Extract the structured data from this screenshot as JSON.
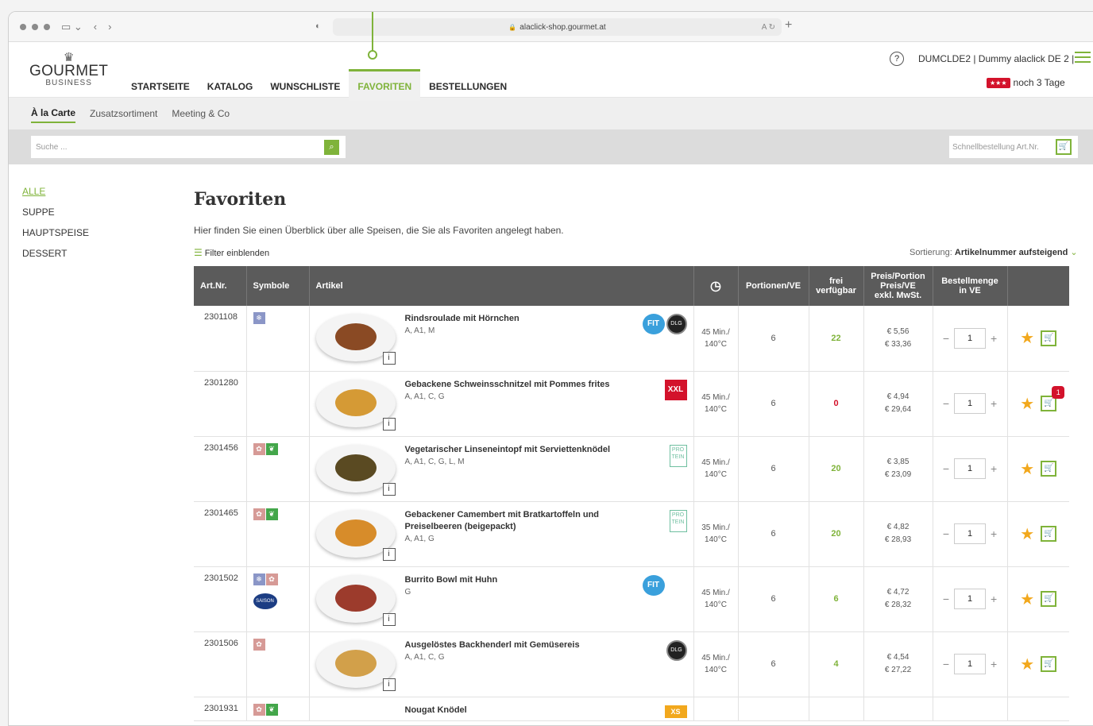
{
  "browser": {
    "url": "alaclick-shop.gourmet.at",
    "translate_label": "A",
    "reload_label": "↻"
  },
  "brand": {
    "line1": "GOURMET",
    "line2": "BUSINESS"
  },
  "nav": {
    "items": [
      "STARTSEITE",
      "KATALOG",
      "WUNSCHLISTE",
      "FAVORITEN",
      "BESTELLUNGEN"
    ],
    "active": "FAVORITEN"
  },
  "user": {
    "label": "DUMCLDE2 | Dummy alaclick DE 2 |",
    "help": "?"
  },
  "trial": {
    "badge": "★★★",
    "text": "noch 3 Tage"
  },
  "subnav": {
    "items": [
      "À la Carte",
      "Zusatzsortiment",
      "Meeting & Co"
    ],
    "active": "À la Carte"
  },
  "search": {
    "placeholder": "Suche ...",
    "quick_placeholder": "Schnellbestellung Art.Nr."
  },
  "sidebar": {
    "items": [
      "ALLE",
      "SUPPE",
      "HAUPTSPEISE",
      "DESSERT"
    ],
    "active": "ALLE"
  },
  "page": {
    "title": "Favoriten",
    "intro": "Hier finden Sie einen Überblick über alle Speisen, die Sie als Favoriten angelegt haben.",
    "filter": "Filter einblenden",
    "sort_label": "Sortierung:",
    "sort_value": "Artikelnummer aufsteigend"
  },
  "table": {
    "headers": {
      "artnr": "Art.Nr.",
      "symbole": "Symbole",
      "artikel": "Artikel",
      "portionen": "Portionen/VE",
      "frei1": "frei",
      "frei2": "verfügbar",
      "preis1": "Preis/Portion",
      "preis2": "Preis/VE",
      "preis3": "exkl. MwSt.",
      "menge1": "Bestellmenge",
      "menge2": "in VE"
    },
    "rows": [
      {
        "artnr": "2301108",
        "name": "Rindsroulade mit Hörnchen",
        "allergens": "A, A1, M",
        "time1": "45 Min./",
        "time2": "140°C",
        "portions": "6",
        "free": "22",
        "price1": "€  5,56",
        "price2": "€ 33,36",
        "qty": "1"
      },
      {
        "artnr": "2301280",
        "name": "Gebackene Schweinsschnitzel mit Pommes frites",
        "allergens": "A, A1, C, G",
        "time1": "45 Min./",
        "time2": "140°C",
        "portions": "6",
        "free": "0",
        "price1": "€  4,94",
        "price2": "€ 29,64",
        "qty": "1",
        "cart_count": "1"
      },
      {
        "artnr": "2301456",
        "name": "Vegetarischer Linseneintopf mit Serviettenknödel",
        "allergens": "A, A1, C, G, L, M",
        "time1": "45 Min./",
        "time2": "140°C",
        "portions": "6",
        "free": "20",
        "price1": "€  3,85",
        "price2": "€ 23,09",
        "qty": "1"
      },
      {
        "artnr": "2301465",
        "name": "Gebackener Camembert mit Bratkartoffeln und Preiselbeeren (beigepackt)",
        "allergens": "A, A1, G",
        "time1": "35 Min./",
        "time2": "140°C",
        "portions": "6",
        "free": "20",
        "price1": "€  4,82",
        "price2": "€ 28,93",
        "qty": "1"
      },
      {
        "artnr": "2301502",
        "name": "Burrito Bowl mit Huhn",
        "allergens": "G",
        "time1": "45 Min./",
        "time2": "140°C",
        "portions": "6",
        "free": "6",
        "price1": "€  4,72",
        "price2": "€ 28,32",
        "qty": "1",
        "saison": "SAISON"
      },
      {
        "artnr": "2301506",
        "name": "Ausgelöstes Backhenderl mit Gemüsereis",
        "allergens": "A, A1, C, G",
        "time1": "45 Min./",
        "time2": "140°C",
        "portions": "6",
        "free": "4",
        "price1": "€  4,54",
        "price2": "€ 27,22",
        "qty": "1"
      },
      {
        "artnr": "2301931",
        "name": "Nougat Knödel"
      }
    ],
    "logos": {
      "fit": "FIT",
      "dlg": "DLG",
      "xxl": "XXL",
      "pro": "PRO TEIN",
      "xs": "XS"
    },
    "info_label": "i"
  },
  "colors": {
    "accent": "#7fb33a",
    "header_bg": "#5b5b5b",
    "alert": "#d3122b"
  }
}
